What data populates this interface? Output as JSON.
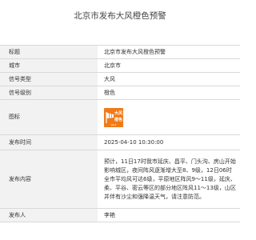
{
  "page": {
    "title": "北京市发布大风橙色预警"
  },
  "rows": {
    "title": {
      "label": "标题",
      "value": "北京市发布大风橙色预警"
    },
    "city": {
      "label": "城市",
      "value": "北京市"
    },
    "signal_type": {
      "label": "信号类型",
      "value": "大风"
    },
    "signal_level": {
      "label": "信号级别",
      "value": "橙色"
    },
    "icon": {
      "label": "图标",
      "icon_name": "gale-orange-warning-icon",
      "icon_top_text": "大风",
      "icon_bottom_text": "橙色",
      "icon_en_text": "GALE",
      "color": "#f07a18"
    },
    "publish_time": {
      "label": "发布时间",
      "value": "2025-04-10 10:30:00"
    },
    "content": {
      "label": "发布内容",
      "lines": [
        "预计，11日17时我市延庆、昌平、门头沟、房山开始",
        "影响城区，夜间阵风逐渐增大至8、9级，12日06时",
        "全市平均风可达6级，平原地区阵风9～11级，延庆、",
        "柔、平谷、密云等区的部分地区阵风11～13级，山区",
        "并伴有沙尘和强降温天气，请注意防范。"
      ]
    },
    "publisher": {
      "label": "发布人",
      "value": "李艳"
    }
  }
}
